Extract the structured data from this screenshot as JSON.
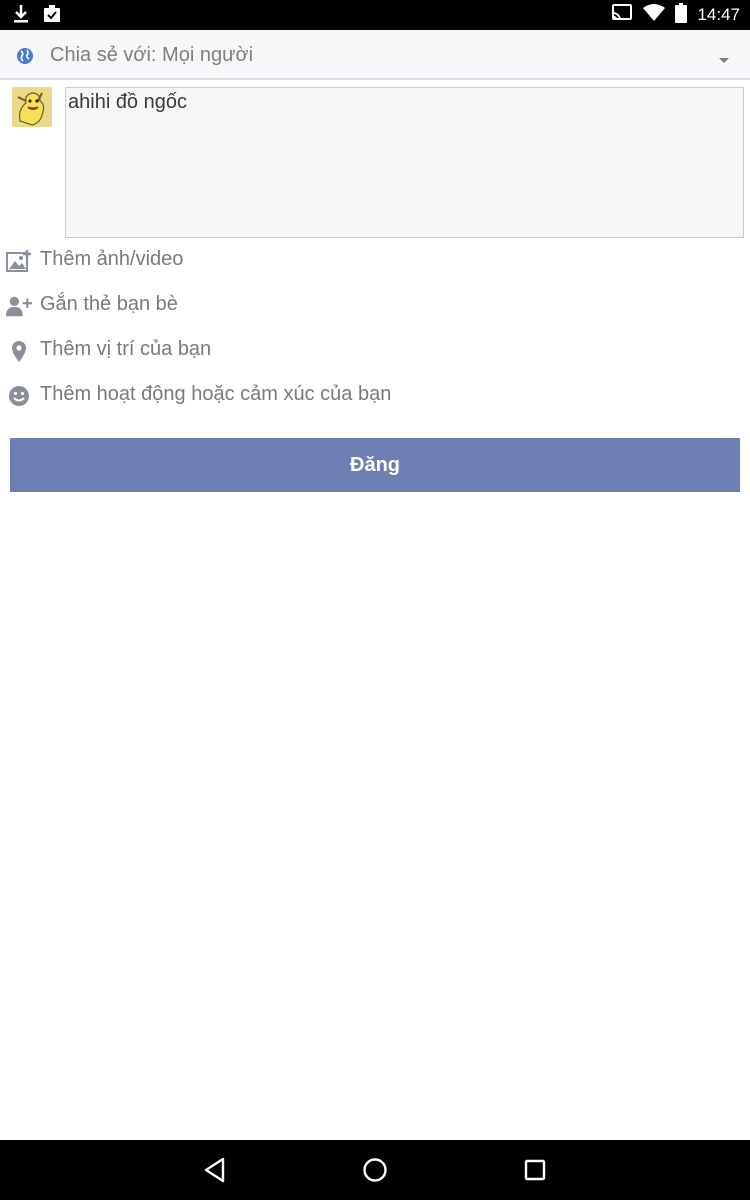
{
  "status_bar": {
    "time": "14:47",
    "icons_left": [
      "download-icon",
      "clipboard-check-icon"
    ],
    "icons_right": [
      "cast-icon",
      "wifi-icon",
      "battery-icon"
    ]
  },
  "share": {
    "label": "Chia sẻ với: Mọi người",
    "icon": "globe-icon",
    "accent": "#4a7bd0"
  },
  "composer": {
    "text": "ahihi đồ ngốc"
  },
  "actions": [
    {
      "icon": "add-photo-icon",
      "label": "Thêm ảnh/video"
    },
    {
      "icon": "add-person-icon",
      "label": "Gắn thẻ bạn bè"
    },
    {
      "icon": "location-pin-icon",
      "label": "Thêm vị trí của bạn"
    },
    {
      "icon": "smiley-icon",
      "label": "Thêm hoạt động hoặc cảm xúc của bạn"
    }
  ],
  "post_button": {
    "label": "Đăng",
    "color": "#6d7fb3"
  },
  "nav": {
    "icons": [
      "back-icon",
      "home-icon",
      "recents-icon"
    ]
  }
}
